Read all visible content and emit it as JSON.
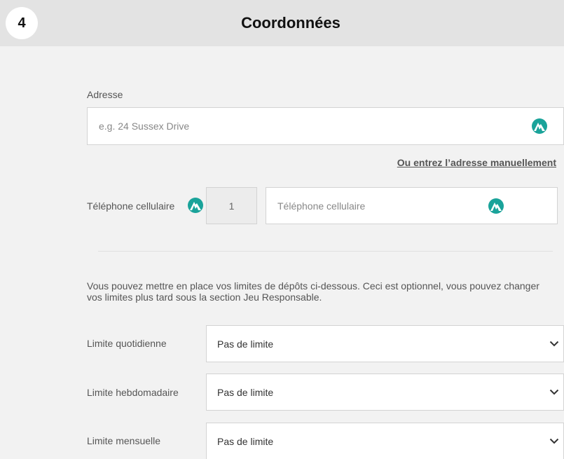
{
  "header": {
    "step": "4",
    "title": "Coordonnées"
  },
  "address": {
    "label": "Adresse",
    "placeholder": "e.g. 24 Sussex Drive",
    "manual_link": "Ou entrez l’adresse manuellement"
  },
  "phone": {
    "label": "Téléphone cellulaire",
    "prefix": "1",
    "placeholder": "Téléphone cellulaire"
  },
  "limits": {
    "info": "Vous pouvez mettre en place vos limites de dépôts ci-dessous. Ceci est optionnel, vous pouvez changer vos limites plus tard sous la section Jeu Responsable.",
    "daily": {
      "label": "Limite quotidienne",
      "value": "Pas de limite"
    },
    "weekly": {
      "label": "Limite hebdomadaire",
      "value": "Pas de limite"
    },
    "monthly": {
      "label": "Limite mensuelle",
      "value": "Pas de limite"
    }
  },
  "colors": {
    "accent": "#1aa39a",
    "background": "#f2f2f2",
    "header": "#e3e3e3"
  },
  "icons": {
    "field_icon": "nordvpn-mountain-icon",
    "select_icon": "chevron-down-icon"
  }
}
